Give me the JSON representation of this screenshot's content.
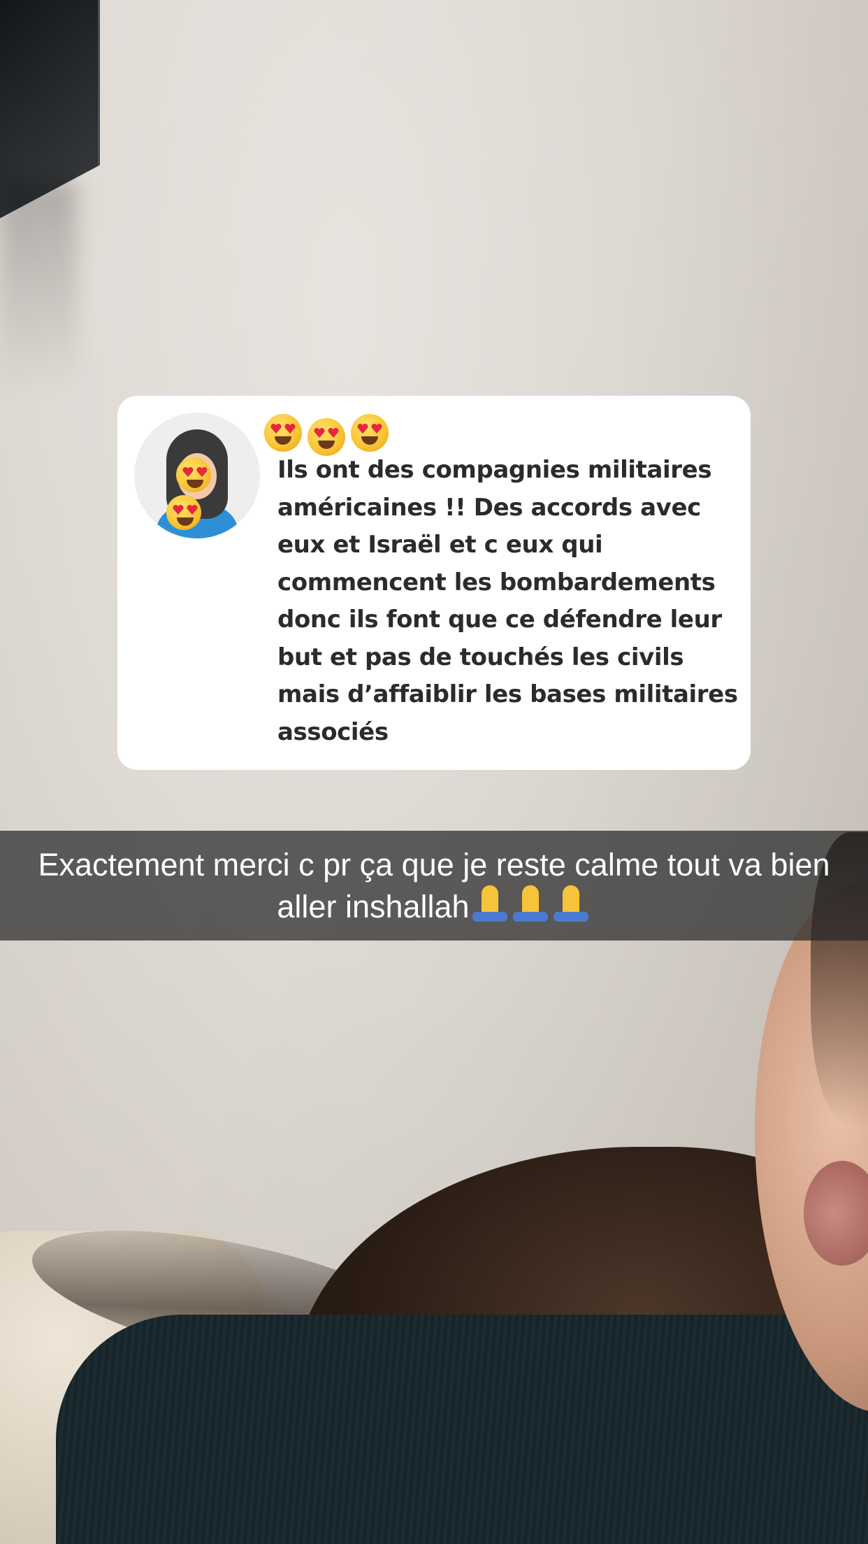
{
  "story": {
    "question_sticker": {
      "avatar_icon": "bitmoji-avatar-with-heart-eyes",
      "reaction_emojis": [
        "heart-eyes",
        "heart-eyes",
        "heart-eyes"
      ],
      "text": "Ils ont des compagnies militaires américaines !! Des accords avec eux et Israël et c eux qui commencent les bombardements donc ils font que ce défendre leur but et pas de touchés les civils mais d’affaiblir les bases militaires associés"
    },
    "caption": {
      "text": "Exactement merci c pr ça que je reste calme tout va bien aller inshallah",
      "trailing_emojis": [
        "folded-hands",
        "folded-hands",
        "folded-hands"
      ]
    }
  },
  "colors": {
    "card_background": "#ffffff",
    "card_text": "#2b2b2b",
    "caption_bar": "rgba(40,40,40,0.72)",
    "caption_text": "#ffffff"
  }
}
